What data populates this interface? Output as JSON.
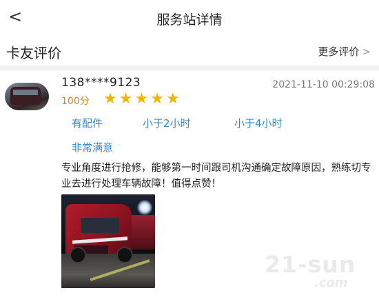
{
  "header": {
    "back_icon": "chevron-left-icon",
    "back_glyph": "<",
    "title": "服务站详情"
  },
  "section": {
    "title": "卡友评价",
    "more_label": "更多评价",
    "more_chevron": ">"
  },
  "review": {
    "phone": "138****9123",
    "timestamp": "2021-11-10 00:29:08",
    "score": "100分",
    "rating": 5,
    "rating_max": 5,
    "tags": [
      "有配件",
      "小于2小时",
      "小于4小时",
      "非常满意"
    ],
    "text": "专业角度进行抢修，能够第一时间跟司机沟通确定故障原因，熟练切专业去进行处理车辆故障！值得点赞！"
  },
  "watermark": {
    "main": "21-sun",
    "sub": ".com"
  },
  "colors": {
    "tag": "#3a86c8",
    "score": "#d58a1a",
    "star": "#f2b400",
    "divider": "#f4f4f4"
  }
}
